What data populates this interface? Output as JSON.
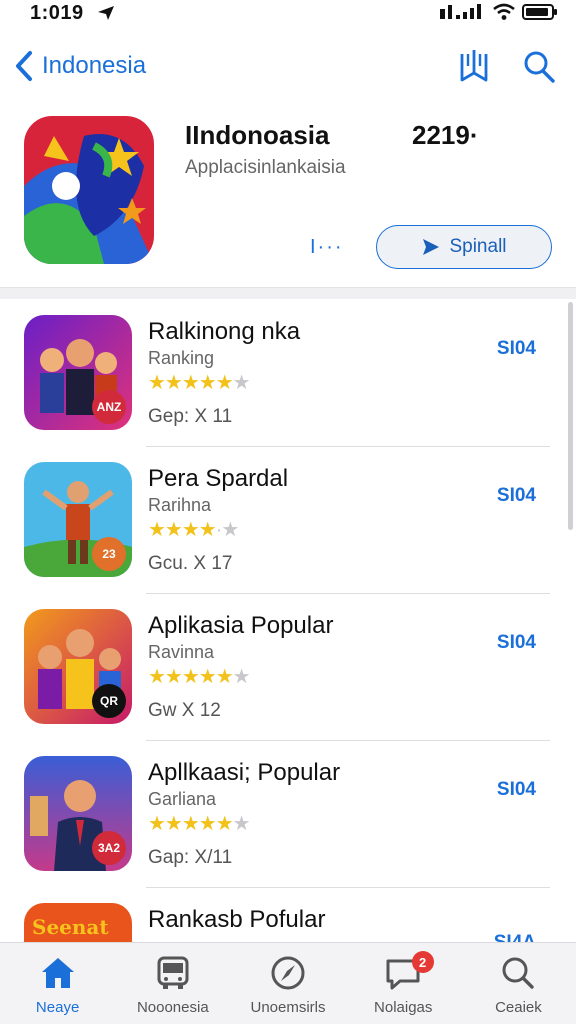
{
  "status_bar": {
    "time": "1:019"
  },
  "nav": {
    "back_label": "Indonesia"
  },
  "app": {
    "title": "IIndonoasia",
    "count": "2219·",
    "subtitle": "Applacisinlankaisia",
    "more": "I···",
    "primary_button": "Spinall"
  },
  "list": [
    {
      "title": "Ralkinong nka",
      "subtitle": "Ranking",
      "rating": 4.5,
      "meta": "Gep: X 11",
      "price": "SI04",
      "badge": "ANZ"
    },
    {
      "title": "Pera Spardal",
      "subtitle": "Rarihna",
      "rating": 4.0,
      "meta": "Gcu. X 17",
      "price": "SI04",
      "badge": "23"
    },
    {
      "title": "Aplikasia Popular",
      "subtitle": "Ravinna",
      "rating": 4.5,
      "meta": "Gw X 12",
      "price": "SI04",
      "badge": "QR"
    },
    {
      "title": "Apllkaasi; Popular",
      "subtitle": "Garliana",
      "rating": 4.5,
      "meta": "Gap: X/11",
      "price": "SI04",
      "badge": "3A2"
    },
    {
      "title": "Rankasb Pofular",
      "subtitle": "",
      "rating": 0,
      "meta": "",
      "price": "SI4A",
      "badge": ""
    }
  ],
  "thumb_text_5": "Seenat",
  "tabs": [
    {
      "label": "Neaye",
      "icon": "home-icon",
      "active": true
    },
    {
      "label": "Nooonesia",
      "icon": "bus-icon",
      "active": false
    },
    {
      "label": "Unoemsirls",
      "icon": "compass-icon",
      "active": false
    },
    {
      "label": "Nolaigas",
      "icon": "message-icon",
      "active": false,
      "badge": "2"
    },
    {
      "label": "Ceaiek",
      "icon": "search-icon",
      "active": false
    }
  ],
  "colors": {
    "accent": "#1a6fd8",
    "star": "#f2c21b",
    "badge_red": "#e53935"
  }
}
